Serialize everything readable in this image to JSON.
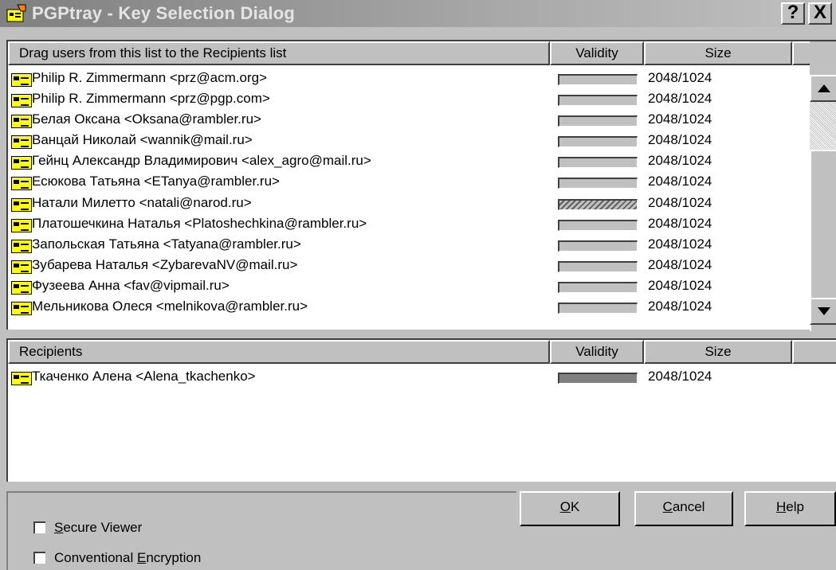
{
  "window": {
    "title": "PGPtray - Key Selection Dialog",
    "help_glyph": "?",
    "close_glyph": "X"
  },
  "source_list": {
    "header_name": "Drag users from this list to the Recipients list",
    "header_validity": "Validity",
    "header_size": "Size",
    "rows": [
      {
        "name": "Philip R. Zimmermann <prz@acm.org>",
        "size": "2048/1024",
        "validity_style": "plain"
      },
      {
        "name": "Philip R. Zimmermann <prz@pgp.com>",
        "size": "2048/1024",
        "validity_style": "plain"
      },
      {
        "name": "Белая Оксана <Oksana@rambler.ru>",
        "size": "2048/1024",
        "validity_style": "plain"
      },
      {
        "name": "Ванцай Николай <wannik@mail.ru>",
        "size": "2048/1024",
        "validity_style": "plain"
      },
      {
        "name": "Гейнц Александр Владимирович <alex_agro@mail.ru>",
        "size": "2048/1024",
        "validity_style": "plain"
      },
      {
        "name": "Есюкова Татьяна <ETanya@rambler.ru>",
        "size": "2048/1024",
        "validity_style": "plain"
      },
      {
        "name": "Натали Милетто <natali@narod.ru>",
        "size": "2048/1024",
        "validity_style": "hatched"
      },
      {
        "name": "Платошечкина Наталья <Platoshechkina@rambler.ru>",
        "size": "2048/1024",
        "validity_style": "plain"
      },
      {
        "name": "Запольская Татьяна <Tatyana@rambler.ru>",
        "size": "2048/1024",
        "validity_style": "plain"
      },
      {
        "name": "Зубарева Наталья <ZybarevaNV@mail.ru>",
        "size": "2048/1024",
        "validity_style": "plain"
      },
      {
        "name": "Фузеева Анна <fav@vipmail.ru>",
        "size": "2048/1024",
        "validity_style": "plain"
      },
      {
        "name": "Мельникова Олеся <melnikova@rambler.ru>",
        "size": "2048/1024",
        "validity_style": "plain"
      }
    ]
  },
  "recipients_list": {
    "header_name": "Recipients",
    "header_validity": "Validity",
    "header_size": "Size",
    "rows": [
      {
        "name": "Ткаченко Алена <Alena_tkachenko>",
        "size": "2048/1024",
        "validity_style": "dark"
      }
    ]
  },
  "options": {
    "secure_viewer": {
      "prefix": "",
      "accel": "S",
      "suffix": "ecure Viewer",
      "checked": false
    },
    "conventional_encryption": {
      "prefix": "Conventional ",
      "accel": "E",
      "suffix": "ncryption",
      "checked": false
    }
  },
  "buttons": {
    "ok": {
      "accel": "O",
      "rest": "K"
    },
    "cancel": {
      "accel": "C",
      "rest": "ancel"
    },
    "help": {
      "accel": "H",
      "rest": "elp"
    }
  },
  "icons": {
    "title": "pgp-key-window-icon",
    "row": "key-icon",
    "scroll_up": "arrow-up-icon",
    "scroll_down": "arrow-down-icon"
  }
}
